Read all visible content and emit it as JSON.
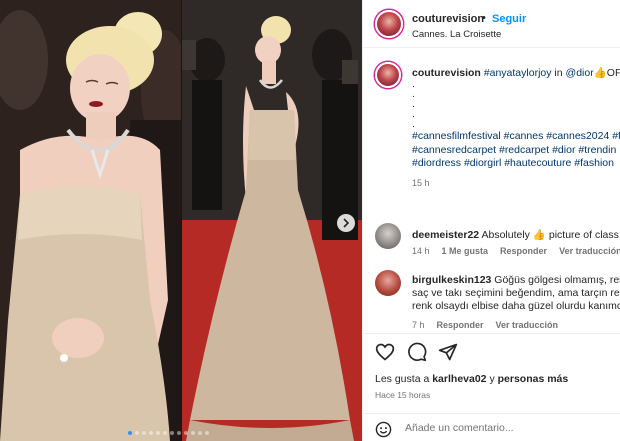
{
  "post": {
    "username": "couturevision",
    "follow_label": "Seguir",
    "separator": "•",
    "location": "Cannes. La Croisette"
  },
  "caption": {
    "username": "couturevision",
    "mention": "#anyataylorjoy",
    "in_text": "in",
    "brand": "@dior",
    "thumbs_emoji": "👍",
    "trailing_text": "OF",
    "dot": ".",
    "hashtags_line1": "#cannesfilmfestival #cannes #cannes2024 #f",
    "hashtags_line2": "#cannesredcarpet #redcarpet #dior #trendin",
    "hashtags_line3": "#diordress #diorgirl #hautecouture #fashion",
    "age": "15 h"
  },
  "comments": [
    {
      "username": "deemeister22",
      "text_before": "Absolutely",
      "emoji": "👍",
      "text_after": "picture of class",
      "age": "14 h",
      "likes_label": "1 Me gusta",
      "reply_label": "Responder",
      "translate_label": "Ver traducción"
    },
    {
      "username": "birgulkeskin123",
      "line1": "Göğüs gölgesi olmamış, ren",
      "line2": "saç ve takı seçimini beğendim, ama tarçın ren",
      "line3": "renk olsaydı elbise daha güzel olurdu kanımc",
      "age": "7 h",
      "reply_label": "Responder",
      "translate_label": "Ver traducción"
    }
  ],
  "engagement": {
    "likes_prefix": "Les gusta a",
    "liker": "karlheva02",
    "likes_conj": "y",
    "others": "personas más",
    "time_ago": "Hace 15 horas"
  },
  "add_comment": {
    "placeholder": "Añade un comentario..."
  },
  "icons": {
    "like": "heart-icon",
    "comment": "comment-icon",
    "share": "send-icon",
    "emoji": "emoji-icon",
    "next": "chevron-right-icon"
  },
  "colors": {
    "accent": "#0095f6",
    "link": "#00376b",
    "muted": "#737373",
    "border": "#efefef"
  }
}
